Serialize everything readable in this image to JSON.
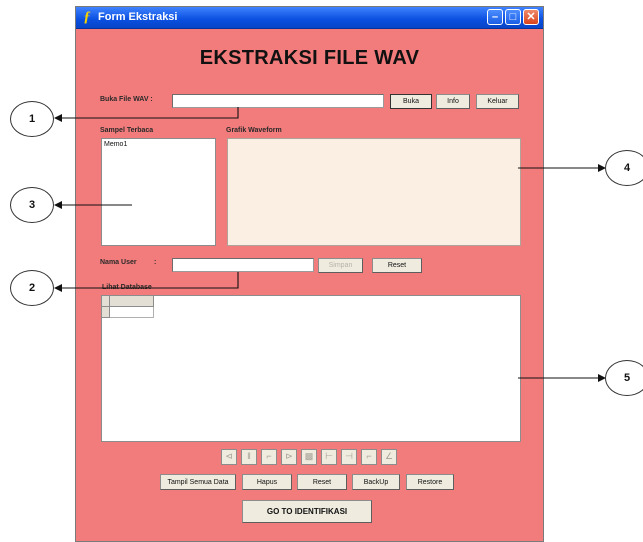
{
  "window": {
    "app_icon": "ƒ",
    "title": "Form Ekstraksi",
    "controls": {
      "minimize": "–",
      "maximize": "□",
      "close": "✕"
    }
  },
  "heading": "EKSTRAKSI FILE WAV",
  "open_file": {
    "label": "Buka File WAV :",
    "value": "",
    "buttons": {
      "open": "Buka",
      "info": "Info",
      "exit": "Keluar"
    }
  },
  "sample": {
    "label": "Sampel Terbaca",
    "memo_text": "Memo1"
  },
  "waveform": {
    "label": "Grafik Waveform"
  },
  "user": {
    "label": "Nama User",
    "colon": ":",
    "value": "",
    "buttons": {
      "save": "Simpan",
      "reset": "Reset"
    }
  },
  "database": {
    "label": "Lihat Database"
  },
  "navigator": {
    "buttons": [
      {
        "name": "first",
        "glyph": "⊲"
      },
      {
        "name": "prior",
        "glyph": "‖"
      },
      {
        "name": "next",
        "glyph": "⌐"
      },
      {
        "name": "last",
        "glyph": "⊳"
      },
      {
        "name": "insert",
        "glyph": "▩"
      },
      {
        "name": "delete",
        "glyph": "⊢"
      },
      {
        "name": "edit",
        "glyph": "⊣"
      },
      {
        "name": "post",
        "glyph": "⌐"
      },
      {
        "name": "cancel",
        "glyph": "∠"
      }
    ]
  },
  "actions": {
    "show_all": "Tampil Semua Data",
    "delete": "Hapus",
    "reset": "Reset",
    "backup": "BackUp",
    "restore": "Restore"
  },
  "go_button": "GO TO IDENTIFIKASI",
  "callouts": [
    "1",
    "2",
    "3",
    "4",
    "5"
  ]
}
